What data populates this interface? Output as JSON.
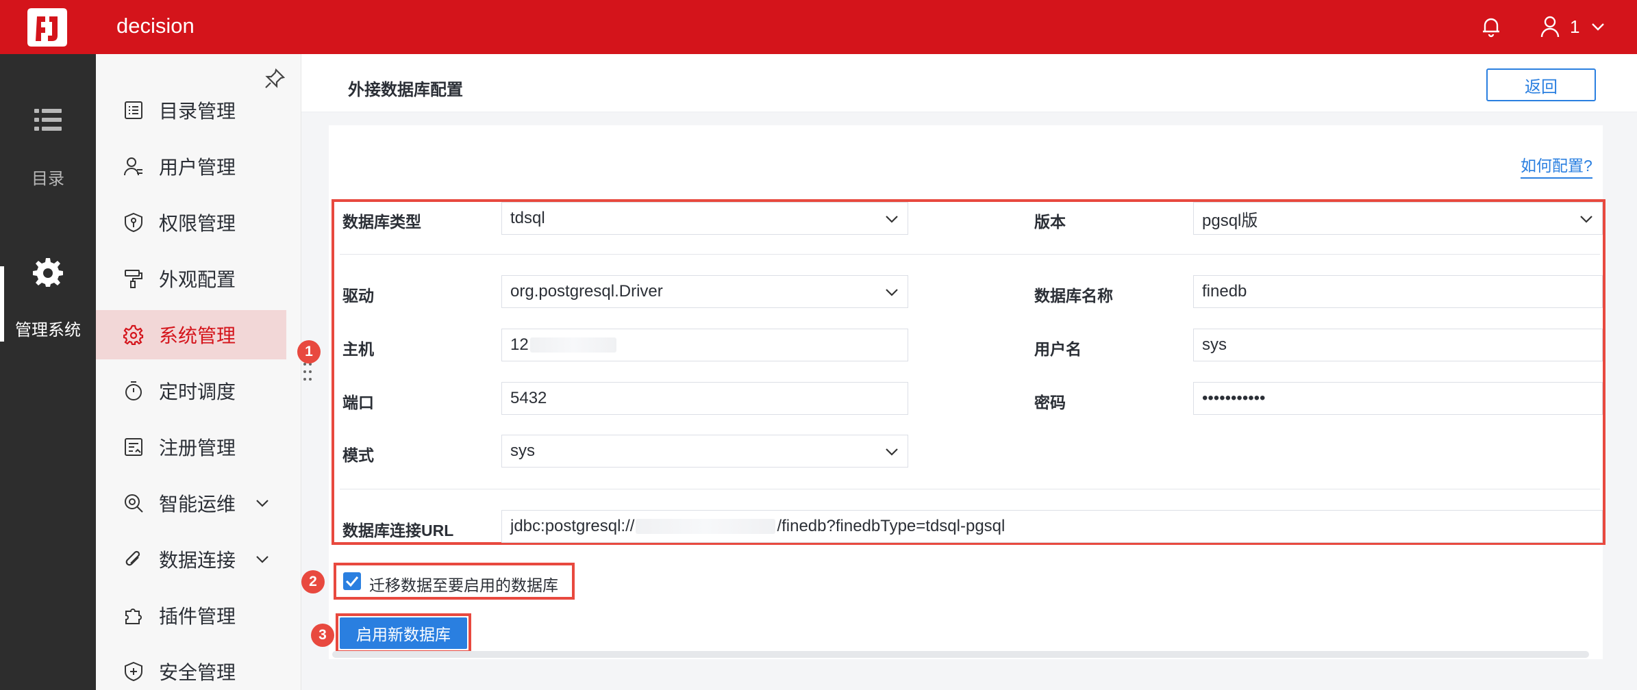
{
  "app": {
    "title": "decision",
    "user": "1"
  },
  "rail": {
    "items": [
      {
        "label": "目录"
      },
      {
        "label": "管理系统"
      }
    ]
  },
  "nav": {
    "items": [
      {
        "label": "目录管理"
      },
      {
        "label": "用户管理"
      },
      {
        "label": "权限管理"
      },
      {
        "label": "外观配置"
      },
      {
        "label": "系统管理"
      },
      {
        "label": "定时调度"
      },
      {
        "label": "注册管理"
      },
      {
        "label": "智能运维"
      },
      {
        "label": "数据连接"
      },
      {
        "label": "插件管理"
      },
      {
        "label": "安全管理"
      }
    ]
  },
  "header": {
    "title": "外接数据库配置",
    "back_label": "返回"
  },
  "help": {
    "label": "如何配置?"
  },
  "form": {
    "db_type": {
      "label": "数据库类型",
      "value": "tdsql"
    },
    "version": {
      "label": "版本",
      "value": "pgsql版"
    },
    "driver": {
      "label": "驱动",
      "value": "org.postgresql.Driver"
    },
    "db_name": {
      "label": "数据库名称",
      "value": "finedb"
    },
    "host": {
      "label": "主机",
      "value": "12"
    },
    "username": {
      "label": "用户名",
      "value": "sys"
    },
    "port": {
      "label": "端口",
      "value": "5432"
    },
    "password": {
      "label": "密码",
      "value": "•••••••••••"
    },
    "schema": {
      "label": "模式",
      "value": "sys"
    },
    "url": {
      "label": "数据库连接URL",
      "prefix": "jdbc:postgresql://",
      "suffix": "/finedb?finedbType=tdsql-pgsql"
    }
  },
  "migrate": {
    "label": "迁移数据至要启用的数据库",
    "checked": true
  },
  "enable": {
    "label": "启用新数据库"
  },
  "badges": [
    "1",
    "2",
    "3"
  ]
}
